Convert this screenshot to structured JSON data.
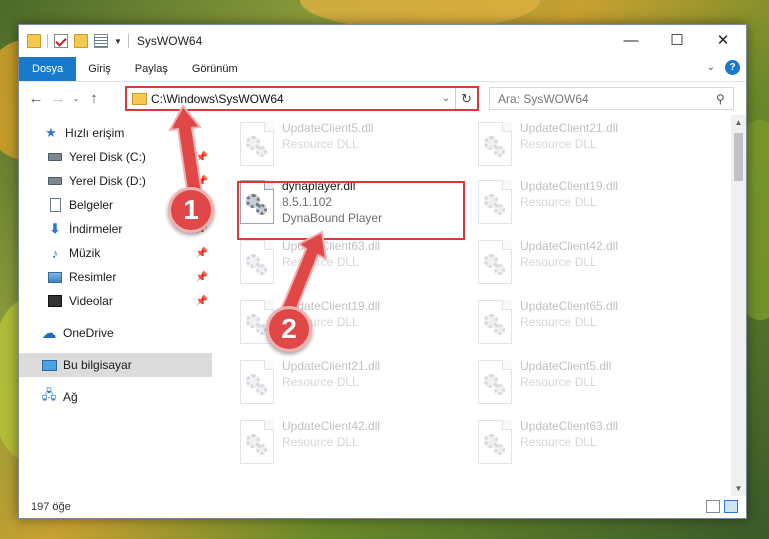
{
  "window": {
    "title": "SysWOW64",
    "controls": {
      "minimize": "—",
      "maximize": "☐",
      "close": "✕"
    }
  },
  "ribbon": {
    "tabs": [
      "Dosya",
      "Giriş",
      "Paylaş",
      "Görünüm"
    ],
    "help": "?",
    "collapse": "⌄"
  },
  "address": {
    "path": "C:\\Windows\\SysWOW64",
    "refresh": "↻",
    "dropdown": "⌄"
  },
  "search": {
    "placeholder": "Ara: SysWOW64",
    "icon": "⚲"
  },
  "nav_buttons": {
    "back": "←",
    "forward": "→",
    "recent": "⌄",
    "up": "↑"
  },
  "nav_pane": {
    "quick_access": "Hızlı erişim",
    "items": [
      {
        "label": "Yerel Disk (C:)",
        "icon": "drive-icon",
        "pinned": true
      },
      {
        "label": "Yerel Disk (D:)",
        "icon": "drive-icon",
        "pinned": true
      },
      {
        "label": "Belgeler",
        "icon": "documents-icon",
        "pinned": true
      },
      {
        "label": "İndirmeler",
        "icon": "downloads-icon",
        "pinned": true
      },
      {
        "label": "Müzik",
        "icon": "music-icon",
        "pinned": true
      },
      {
        "label": "Resimler",
        "icon": "pictures-icon",
        "pinned": true
      },
      {
        "label": "Videolar",
        "icon": "videos-icon",
        "pinned": true
      }
    ],
    "onedrive": "OneDrive",
    "this_pc": "Bu bilgisayar",
    "network": "Ağ"
  },
  "files": {
    "left_column": [
      {
        "name": "UpdateClient5.dll",
        "sub": "Resource DLL",
        "faded": true
      },
      {
        "name": "dynaplayer.dll",
        "sub": "8.5.1.102",
        "sub2": "DynaBound Player",
        "faded": false,
        "highlighted": true
      },
      {
        "name": "UpdateClient63.dll",
        "sub": "Resource DLL",
        "faded": true
      },
      {
        "name": "UpdateClient19.dll",
        "sub": "Resource DLL",
        "faded": true
      },
      {
        "name": "UpdateClient21.dll",
        "sub": "Resource DLL",
        "faded": true
      },
      {
        "name": "UpdateClient42.dll",
        "sub": "Resource DLL",
        "faded": true
      }
    ],
    "right_column": [
      {
        "name": "UpdateClient21.dll",
        "sub": "Resource DLL",
        "faded": true
      },
      {
        "name": "UpdateClient19.dll",
        "sub": "Resource DLL",
        "faded": true
      },
      {
        "name": "UpdateClient42.dll",
        "sub": "Resource DLL",
        "faded": true
      },
      {
        "name": "UpdateClient65.dll",
        "sub": "Resource DLL",
        "faded": true
      },
      {
        "name": "UpdateClient5.dll",
        "sub": "Resource DLL",
        "faded": true
      },
      {
        "name": "UpdateClient63.dll",
        "sub": "Resource DLL",
        "faded": true
      }
    ]
  },
  "status": {
    "count": "197 öğe"
  },
  "callouts": {
    "first": "1",
    "second": "2"
  },
  "colors": {
    "accent": "#1979ca",
    "highlight": "#d8393f",
    "callout": "#e04848"
  }
}
